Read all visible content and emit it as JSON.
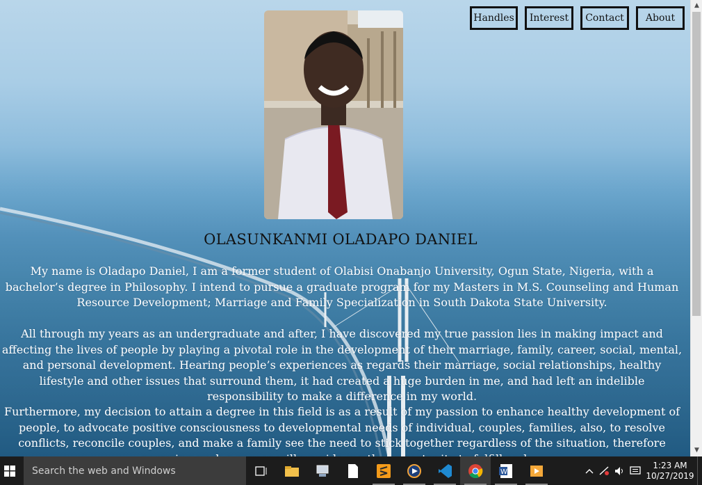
{
  "nav": {
    "items": [
      "Handles",
      "Interest",
      "Contact",
      "About"
    ]
  },
  "profile": {
    "name": "OLASUNKANMI OLADAPO DANIEL",
    "paragraphs": [
      "My name is Oladapo Daniel, I am a former student of Olabisi Onabanjo University, Ogun State, Nigeria, with a bachelor’s degree in Philosophy. I intend to pursue a graduate program for my Masters in M.S. Counseling and Human Resource Development; Marriage and Family Specialization in South Dakota State University.",
      "All through my years as an undergraduate and after, I have discovered my true passion lies in making impact and affecting the lives of people by playing a pivotal role in the development of their marriage, family, career, social, mental, and personal development. Hearing people’s experiences as regards their marriage, social relationships, healthy lifestyle and other issues that surround them, it had created a huge burden in me, and had left an indelible responsibility to make a difference in my world.",
      "Furthermore, my decision to attain a degree in this field is as a result of my passion to enhance healthy development of people, to advocate positive consciousness to developmental needs of individual, couples, families, also, to resolve conflicts, reconcile couples, and make a family see the need to stick together regardless of the situation, therefore pursuing such a career will provide me the opportunity to fulfill and ..."
    ]
  },
  "taskbar": {
    "search_placeholder": "Search the web and Windows",
    "time": "1:23 AM",
    "date": "10/27/2019",
    "icons": [
      "task-view-icon",
      "file-explorer-icon",
      "network-icon",
      "document-icon",
      "sublime-text-icon",
      "media-player-icon",
      "vscode-icon",
      "chrome-icon",
      "word-icon",
      "video-icon"
    ]
  },
  "colors": {
    "nav_border": "#111111",
    "paragraph_text": "#ffffff",
    "name_text": "#111111",
    "taskbar_bg": "#1c1c1c"
  }
}
